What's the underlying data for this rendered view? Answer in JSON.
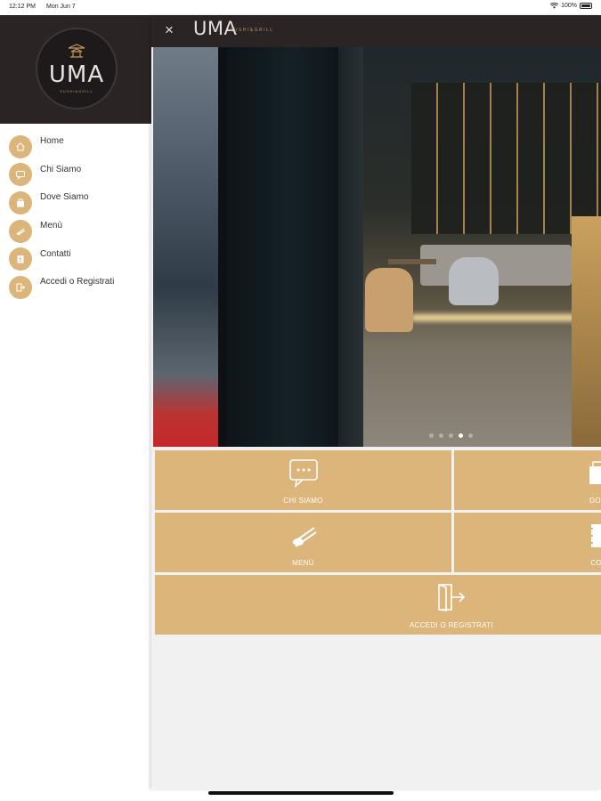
{
  "status_bar": {
    "time": "12:12 PM",
    "date": "Mon Jun 7",
    "battery": "100%"
  },
  "sidebar": {
    "logo_text": "UMA",
    "logo_sub": "SUSHI&GRILL",
    "items": [
      {
        "label": "Home",
        "icon": "home-icon"
      },
      {
        "label": "Chi Siamo",
        "icon": "chat-icon"
      },
      {
        "label": "Dove Siamo",
        "icon": "building-icon"
      },
      {
        "label": "Menù",
        "icon": "chopsticks-icon"
      },
      {
        "label": "Contatti",
        "icon": "contacts-icon"
      },
      {
        "label": "Accedi o Registrati",
        "icon": "login-icon"
      }
    ]
  },
  "header": {
    "close": "×",
    "logo_text": "UMA",
    "logo_sub": "SUSHI&GRILL"
  },
  "carousel": {
    "dots": 5,
    "active_index": 3
  },
  "tiles": {
    "chi_siamo": "CHI SIAMO",
    "dove_siamo": "DOVE",
    "menu": "MENÙ",
    "contatti": "CON",
    "accedi": "ACCEDI O REGISTRATI"
  },
  "colors": {
    "accent": "#dcb57a",
    "header_bg": "#2a2425"
  }
}
